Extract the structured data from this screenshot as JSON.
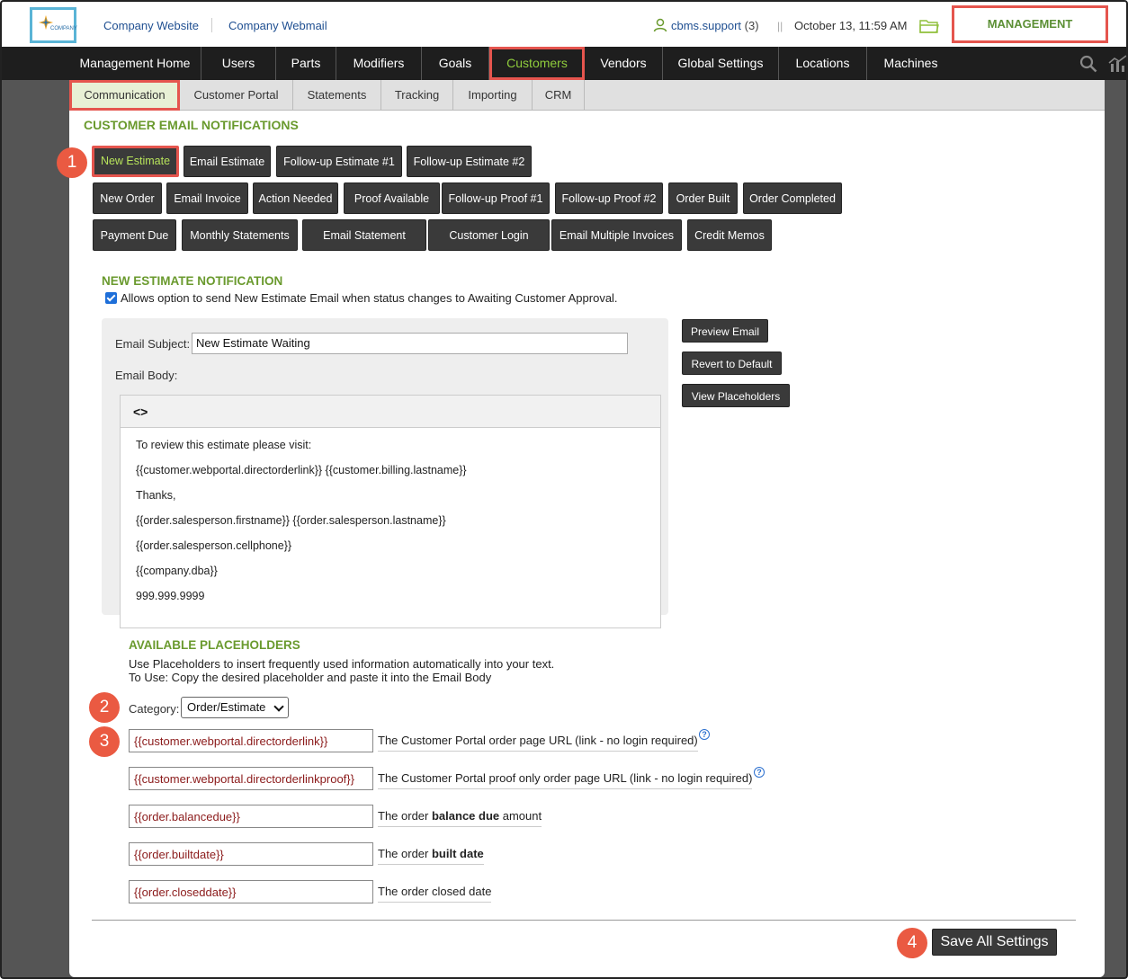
{
  "topbar": {
    "logo_text": "COMPANY",
    "links": [
      "Company Website",
      "Company Webmail"
    ],
    "user_name": "cbms.support",
    "user_count": "(3)",
    "divider": "||",
    "datetime": "October 13, 11:59 AM",
    "management_label": "MANAGEMENT"
  },
  "mainnav": {
    "items": [
      "Management Home",
      "Users",
      "Parts",
      "Modifiers",
      "Goals",
      "Customers",
      "Vendors",
      "Global Settings",
      "Locations",
      "Machines"
    ],
    "active": "Customers"
  },
  "subnav": {
    "items": [
      "Communication",
      "Customer Portal",
      "Statements",
      "Tracking",
      "Importing",
      "CRM"
    ],
    "active": "Communication"
  },
  "section_title": "CUSTOMER EMAIL NOTIFICATIONS",
  "notification_buttons": {
    "row1": [
      "New Estimate",
      "Email Estimate",
      "Follow-up Estimate #1",
      "Follow-up Estimate #2"
    ],
    "row2": [
      "New Order",
      "Email Invoice",
      "Action Needed",
      "Proof Available",
      "Follow-up Proof #1",
      "Follow-up Proof #2",
      "Order Built",
      "Order Completed"
    ],
    "row3": [
      "Payment Due",
      "Monthly Statements",
      "Email Statement",
      "Customer Login",
      "Email Multiple Invoices",
      "Credit Memos"
    ],
    "active": "New Estimate"
  },
  "notification": {
    "title": "NEW ESTIMATE NOTIFICATION",
    "checkbox_checked": true,
    "checkbox_label": "Allows option to send New Estimate Email when status changes to Awaiting Customer Approval.",
    "subject_label": "Email Subject:",
    "subject_value": "New Estimate Waiting",
    "body_label": "Email Body:",
    "toolbar_icon": "code-icon",
    "body_lines": [
      "To review this estimate please visit:",
      "{{customer.webportal.directorderlink}} {{customer.billing.lastname}}",
      "Thanks,",
      "{{order.salesperson.firstname}} {{order.salesperson.lastname}}",
      "{{order.salesperson.cellphone}}",
      "{{company.dba}}",
      "999.999.9999"
    ],
    "side_buttons": [
      "Preview Email",
      "Revert to Default",
      "View Placeholders"
    ]
  },
  "placeholders": {
    "title": "AVAILABLE PLACEHOLDERS",
    "desc_line1": "Use Placeholders to insert frequently used information automatically into your text.",
    "desc_line2": "To Use: Copy the desired placeholder and paste it into the Email Body",
    "category_label": "Category:",
    "category_value": "Order/Estimate",
    "items": [
      {
        "code": "{{customer.webportal.directorderlink}}",
        "desc_pre": "The Customer Portal order page URL (link - no login required)",
        "desc_bold": "",
        "desc_post": "",
        "help": true
      },
      {
        "code": "{{customer.webportal.directorderlinkproof}}",
        "desc_pre": "The Customer Portal proof only order page URL (link - no login required)",
        "desc_bold": "",
        "desc_post": "",
        "help": true
      },
      {
        "code": "{{order.balancedue}}",
        "desc_pre": "The order ",
        "desc_bold": "balance due",
        "desc_post": " amount",
        "help": false
      },
      {
        "code": "{{order.builtdate}}",
        "desc_pre": "The order ",
        "desc_bold": "built date",
        "desc_post": "",
        "help": false
      },
      {
        "code": "{{order.closeddate}}",
        "desc_pre": "The order closed date",
        "desc_bold": "",
        "desc_post": "",
        "help": false
      }
    ]
  },
  "save_label": "Save All Settings",
  "callouts": [
    "1",
    "2",
    "3",
    "4"
  ],
  "colors": {
    "accent_green": "#6a9a2e",
    "highlight_red": "#e5554e",
    "callout": "#ea5a42",
    "nav_bg": "#1e1e1e",
    "button_bg": "#3a3a3a"
  }
}
